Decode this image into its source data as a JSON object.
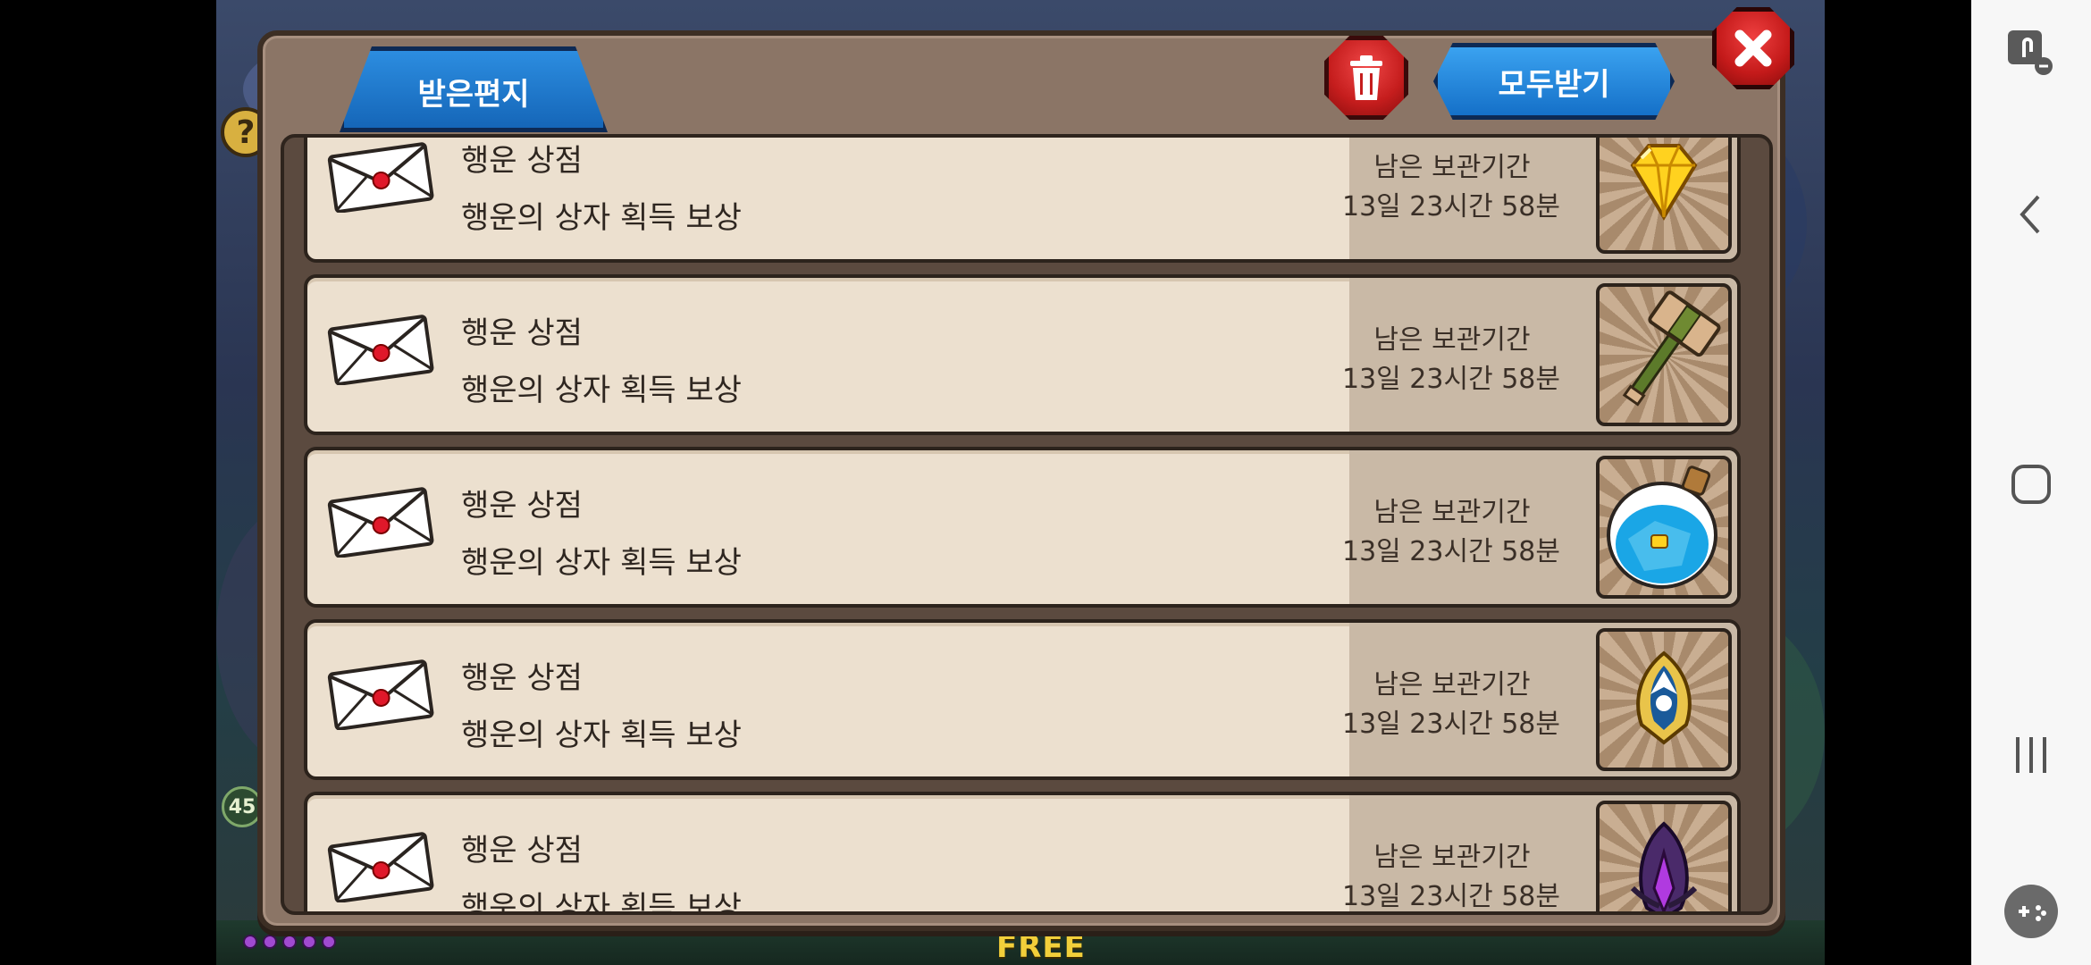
{
  "dialog": {
    "tab_label": "받은편지",
    "receive_all_label": "모두받기"
  },
  "game_bottom": {
    "free_label": "FREE",
    "level_badge": "45",
    "help_badge": "?"
  },
  "mails": [
    {
      "title": "행운 상점",
      "desc": "행운의 상자 획득 보상",
      "retention_label": "남은 보관기간",
      "retention_time": "13일 23시간 58분",
      "item_icon": "diamond-icon"
    },
    {
      "title": "행운 상점",
      "desc": "행운의 상자 획득 보상",
      "retention_label": "남은 보관기간",
      "retention_time": "13일 23시간 58분",
      "item_icon": "hammer-icon"
    },
    {
      "title": "행운 상점",
      "desc": "행운의 상자 획득 보상",
      "retention_label": "남은 보관기간",
      "retention_time": "13일 23시간 58분",
      "item_icon": "potion-bottle-icon"
    },
    {
      "title": "행운 상점",
      "desc": "행운의 상자 획득 보상",
      "retention_label": "남은 보관기간",
      "retention_time": "13일 23시간 58분",
      "item_icon": "winged-emblem-icon"
    },
    {
      "title": "행운 상점",
      "desc": "행운의 상자 획득 보상",
      "retention_label": "남은 보관기간",
      "retention_time": "13일 23시간 58분",
      "item_icon": "dark-crystal-icon"
    }
  ],
  "colors": {
    "accent_blue": "#1e7fd4",
    "danger_red": "#d42525",
    "row_bg": "#ece0cf",
    "panel_bg": "#c9b9a6"
  }
}
